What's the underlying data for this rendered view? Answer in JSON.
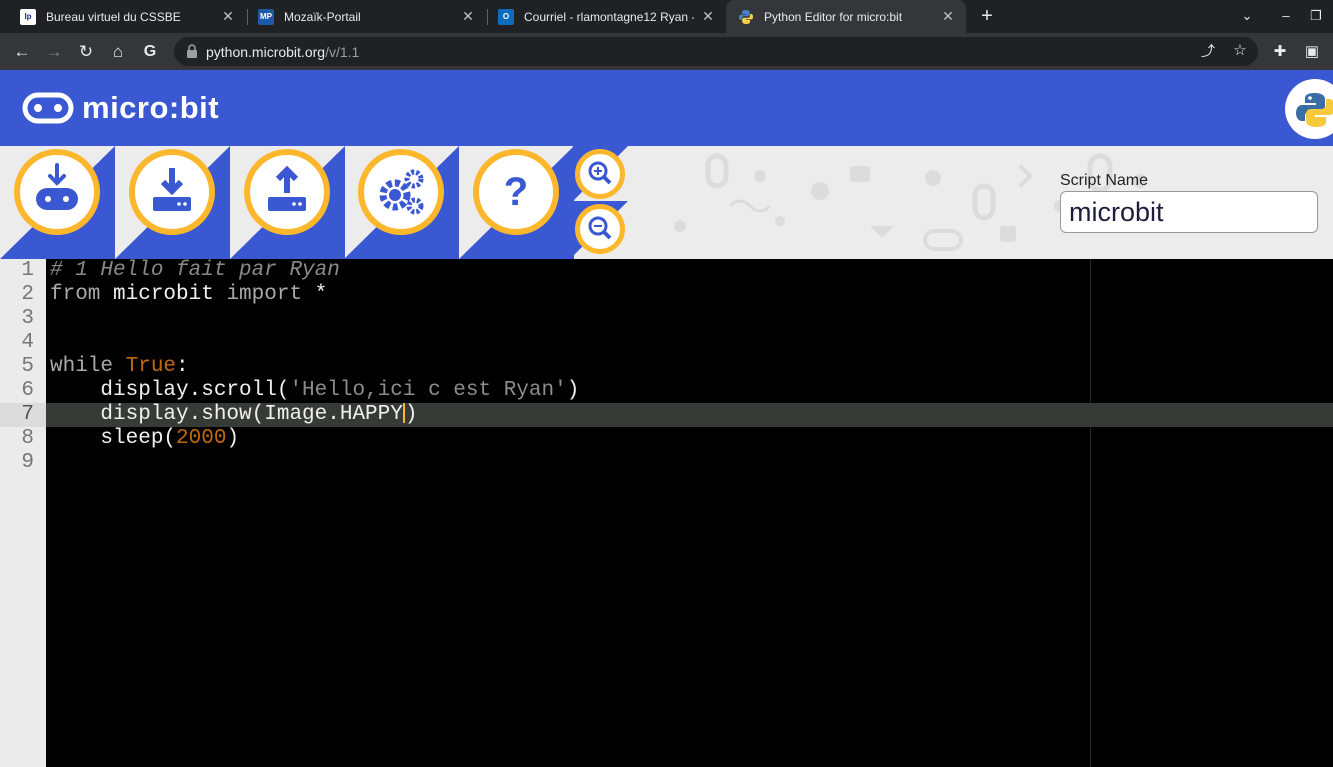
{
  "browser": {
    "tabs": [
      {
        "title": "Bureau virtuel du CSSBE",
        "favicon": "CSSBE"
      },
      {
        "title": "Mozaïk-Portail",
        "favicon": "MP"
      },
      {
        "title": "Courriel - rlamontagne12 Ryan -",
        "favicon": "O"
      },
      {
        "title": "Python Editor for micro:bit",
        "favicon": "python-icon"
      }
    ],
    "url_host": "python.microbit.org",
    "url_path": "/v/1.1"
  },
  "app": {
    "logo_text": "micro:bit",
    "buttons": {
      "download": "Download",
      "save": "Save",
      "load": "Load",
      "snippets": "Snippets",
      "help": "Help"
    },
    "script_name_label": "Script Name",
    "script_name_value": "microbit"
  },
  "editor": {
    "line_numbers": [
      "1",
      "2",
      "3",
      "4",
      "5",
      "6",
      "7",
      "8",
      "9"
    ],
    "line1": "# 1 Hello fait par Ryan",
    "line2_kw1": "from",
    "line2_mod": " microbit ",
    "line2_kw2": "import",
    "line2_rest": " *",
    "line5_kw": "while",
    "line5_bool": "True",
    "line5_colon": ":",
    "line6_pre": "    display.scroll(",
    "line6_str": "'Hello,ici c est Ryan'",
    "line6_post": ")",
    "line7_pre": "    display.show(Image.HAPPY",
    "line7_post": ")",
    "line8_pre": "    sleep(",
    "line8_num": "2000",
    "line8_post": ")"
  },
  "colors": {
    "brand_blue": "#3a58d2",
    "accent_yellow": "#fdb72c"
  }
}
